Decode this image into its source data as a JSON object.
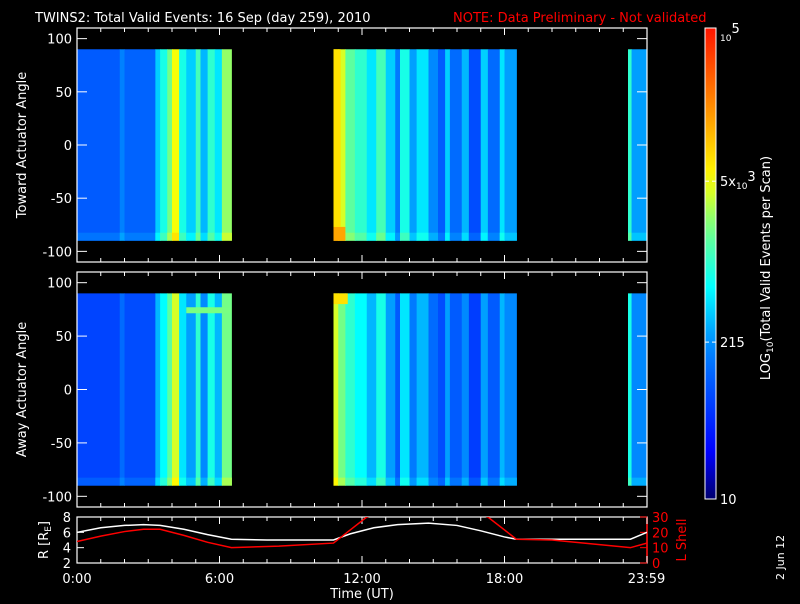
{
  "title": "TWINS2: Total Valid Events: 16 Sep (day 259), 2010",
  "note": "NOTE: Data Preliminary - Not validated",
  "date_stamp": "2 Jun 12",
  "colors": {
    "title": "#ffffff",
    "note": "#ff0000",
    "r_line": "#ffffff",
    "l_line": "#ff0000"
  },
  "chart_data": [
    {
      "type": "heatmap",
      "name": "toward",
      "ylabel": "Toward Actuator Angle",
      "ylim": [
        -110,
        110
      ],
      "yticks": [
        "100",
        "50",
        "0",
        "-50",
        "-100"
      ],
      "ytick_values": [
        100,
        50,
        0,
        -50,
        -100
      ],
      "angle_range": [
        -90,
        90
      ],
      "columns_log10": [
        [
          0,
          1.8,
          2.0
        ],
        [
          1.8,
          2.0,
          2.25
        ],
        [
          2.0,
          3.3,
          2.05
        ],
        [
          3.3,
          3.5,
          2.6
        ],
        [
          3.5,
          3.8,
          2.9
        ],
        [
          3.8,
          4.0,
          3.3
        ],
        [
          4.0,
          4.3,
          3.7
        ],
        [
          4.3,
          4.6,
          2.9
        ],
        [
          4.6,
          5.0,
          2.6
        ],
        [
          5.0,
          5.2,
          3.1
        ],
        [
          5.2,
          5.5,
          2.5
        ],
        [
          5.5,
          5.8,
          3.0
        ],
        [
          5.8,
          6.1,
          2.7
        ],
        [
          6.1,
          6.5,
          3.4
        ],
        [
          10.8,
          11.0,
          3.9
        ],
        [
          11.0,
          11.3,
          3.6
        ],
        [
          11.3,
          11.7,
          3.2
        ],
        [
          11.7,
          12.2,
          3.0
        ],
        [
          12.2,
          12.6,
          2.7
        ],
        [
          12.6,
          13.0,
          3.1
        ],
        [
          13.0,
          13.4,
          2.6
        ],
        [
          13.4,
          13.6,
          2.2
        ],
        [
          13.6,
          14.0,
          2.9
        ],
        [
          14.0,
          14.3,
          2.4
        ],
        [
          14.3,
          14.8,
          2.7
        ],
        [
          14.8,
          15.2,
          2.3
        ],
        [
          15.2,
          15.5,
          2.0
        ],
        [
          15.5,
          15.7,
          2.6
        ],
        [
          15.7,
          16.2,
          2.1
        ],
        [
          16.2,
          16.5,
          2.5
        ],
        [
          16.5,
          17.0,
          1.9
        ],
        [
          17.0,
          17.3,
          2.6
        ],
        [
          17.3,
          17.8,
          2.1
        ],
        [
          17.8,
          18.0,
          2.7
        ],
        [
          18.0,
          18.5,
          2.4
        ],
        [
          23.2,
          23.35,
          3.0
        ],
        [
          23.35,
          23.99,
          2.4
        ]
      ]
    },
    {
      "type": "heatmap",
      "name": "away",
      "ylabel": "Away Actuator Angle",
      "ylim": [
        -110,
        110
      ],
      "yticks": [
        "100",
        "50",
        "0",
        "-50",
        "-100"
      ],
      "ytick_values": [
        100,
        50,
        0,
        -50,
        -100
      ],
      "angle_range": [
        -90,
        90
      ],
      "columns_log10": [
        [
          0,
          1.8,
          1.85
        ],
        [
          1.8,
          2.0,
          2.1
        ],
        [
          2.0,
          3.3,
          1.9
        ],
        [
          3.3,
          3.5,
          2.5
        ],
        [
          3.5,
          3.8,
          2.8
        ],
        [
          3.8,
          4.0,
          3.2
        ],
        [
          4.0,
          4.3,
          3.6
        ],
        [
          4.3,
          4.6,
          2.7
        ],
        [
          4.6,
          5.0,
          2.4
        ],
        [
          5.0,
          5.2,
          3.0
        ],
        [
          5.2,
          5.5,
          2.3
        ],
        [
          5.5,
          5.8,
          2.9
        ],
        [
          5.8,
          6.1,
          2.5
        ],
        [
          6.1,
          6.5,
          3.3
        ],
        [
          10.8,
          11.0,
          3.6
        ],
        [
          11.0,
          11.3,
          3.3
        ],
        [
          11.3,
          11.7,
          3.0
        ],
        [
          11.7,
          12.2,
          2.8
        ],
        [
          12.2,
          12.6,
          2.5
        ],
        [
          12.6,
          13.0,
          2.9
        ],
        [
          13.0,
          13.4,
          2.4
        ],
        [
          13.4,
          13.6,
          2.0
        ],
        [
          13.6,
          14.0,
          2.7
        ],
        [
          14.0,
          14.3,
          2.2
        ],
        [
          14.3,
          14.8,
          2.5
        ],
        [
          14.8,
          15.2,
          2.1
        ],
        [
          15.2,
          15.5,
          1.9
        ],
        [
          15.5,
          15.7,
          2.4
        ],
        [
          15.7,
          16.2,
          2.0
        ],
        [
          16.2,
          16.5,
          2.3
        ],
        [
          16.5,
          17.0,
          1.8
        ],
        [
          17.0,
          17.3,
          2.4
        ],
        [
          17.3,
          17.8,
          2.0
        ],
        [
          17.8,
          18.0,
          2.5
        ],
        [
          18.0,
          18.5,
          2.3
        ],
        [
          23.2,
          23.35,
          2.9
        ],
        [
          23.35,
          23.99,
          2.3
        ]
      ]
    },
    {
      "type": "line",
      "name": "orbit",
      "xlabel": "Time (UT)",
      "xticks": [
        "0:00",
        "6:00",
        "12:00",
        "18:00",
        "23:59"
      ],
      "xtick_values": [
        0,
        6,
        12,
        18,
        23.98
      ],
      "ylabel_left": "R [R",
      "ylabel_left_sub": "E",
      "ylabel_left_end": "]",
      "ylim_left": [
        2,
        8
      ],
      "yticks_left": [
        "8",
        "6",
        "4",
        "2"
      ],
      "ytick_values_left": [
        8,
        6,
        4,
        2
      ],
      "ylabel_right": "L Shell",
      "ylim_right": [
        0,
        30
      ],
      "yticks_right": [
        "30",
        "20",
        "10",
        "0"
      ],
      "ytick_values_right": [
        30,
        20,
        10,
        0
      ],
      "series": [
        {
          "name": "R",
          "axis": "left",
          "x": [
            0,
            1,
            2,
            2.8,
            3.5,
            4.5,
            5.5,
            6.5,
            8,
            10.8,
            11.5,
            12.5,
            13.5,
            14.8,
            16,
            17,
            18,
            18.5,
            20,
            23.3,
            24
          ],
          "y": [
            6.0,
            6.6,
            6.9,
            7.0,
            6.9,
            6.4,
            5.7,
            5.1,
            5.0,
            5.0,
            5.8,
            6.6,
            7.0,
            7.2,
            6.9,
            6.2,
            5.4,
            5.1,
            5.1,
            5.1,
            6.0
          ]
        },
        {
          "name": "L Shell",
          "axis": "right",
          "x": [
            0,
            1,
            2,
            2.8,
            3.5,
            4.5,
            5.5,
            6.5,
            8.5,
            10.8,
            12.2,
            12.4
          ],
          "y": [
            14,
            17.5,
            20.5,
            22,
            22,
            18,
            13.5,
            10,
            11,
            13,
            30,
            31
          ]
        },
        {
          "name": "L Shell (post)",
          "axis": "right",
          "x": [
            17.1,
            17.3,
            18.5,
            20,
            23.3,
            24
          ],
          "y": [
            31,
            30,
            15.5,
            15,
            10,
            13
          ]
        }
      ]
    },
    {
      "type": "colorbar",
      "label_prefix": "LOG",
      "label_sub": "10",
      "label_rest": "(Total Valid Events per Scan)",
      "ticks": [
        {
          "value": 100000,
          "base": "10",
          "exp": "5",
          "prefix": ""
        },
        {
          "value": 5000,
          "base": "10",
          "exp": "3",
          "prefix": "5x"
        },
        {
          "value": 215,
          "text": "215"
        },
        {
          "value": 10,
          "text": "10"
        }
      ],
      "range_log10": [
        1,
        5
      ]
    }
  ]
}
